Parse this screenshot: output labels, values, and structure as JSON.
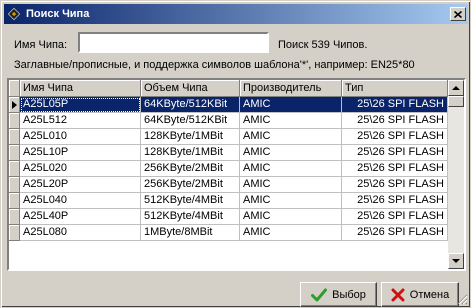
{
  "window": {
    "title": "Поиск Чипа"
  },
  "search": {
    "label": "Имя Чипа:",
    "value": "",
    "found_text": "Поиск 539 Чипов.",
    "hint": "Заглавные/прописные, и поддержка символов шаблона'*', например: EN25*80"
  },
  "table": {
    "headers": [
      "Имя Чипа",
      "Объем Чипа",
      "Производитель",
      "Тип"
    ],
    "rows": [
      [
        "A25L05P",
        "64KByte/512KBit",
        "AMIC",
        "25\\26 SPI FLASH"
      ],
      [
        "A25L512",
        "64KByte/512KBit",
        "AMIC",
        "25\\26 SPI FLASH"
      ],
      [
        "A25L010",
        "128KByte/1MBit",
        "AMIC",
        "25\\26 SPI FLASH"
      ],
      [
        "A25L10P",
        "128KByte/1MBit",
        "AMIC",
        "25\\26 SPI FLASH"
      ],
      [
        "A25L020",
        "256KByte/2MBit",
        "AMIC",
        "25\\26 SPI FLASH"
      ],
      [
        "A25L20P",
        "256KByte/2MBit",
        "AMIC",
        "25\\26 SPI FLASH"
      ],
      [
        "A25L040",
        "512KByte/4MBit",
        "AMIC",
        "25\\26 SPI FLASH"
      ],
      [
        "A25L40P",
        "512KByte/4MBit",
        "AMIC",
        "25\\26 SPI FLASH"
      ],
      [
        "A25L080",
        "1MByte/8MBit",
        "AMIC",
        "25\\26 SPI FLASH"
      ]
    ],
    "selected_row": 0
  },
  "buttons": {
    "ok_label": "Выбор",
    "cancel_label": "Отмена"
  },
  "colors": {
    "title_start": "#0a246a",
    "title_end": "#a6caf0",
    "selection": "#0a246a",
    "ok_icon": "#2aa02a",
    "cancel_icon": "#d01010"
  },
  "icons": {
    "title": "chip-icon",
    "close": "close-icon",
    "ok": "checkmark-icon",
    "cancel": "cross-icon"
  }
}
